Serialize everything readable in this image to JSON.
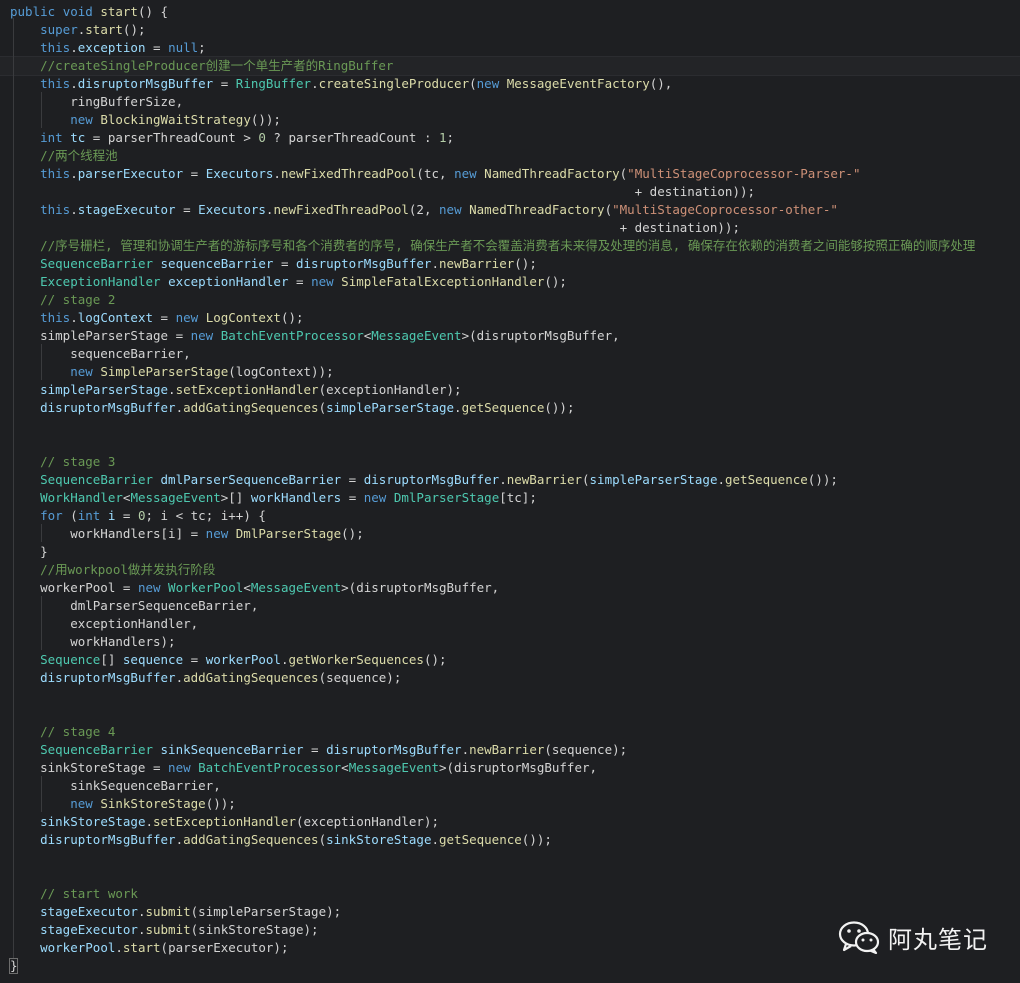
{
  "editor": {
    "background": "#1e1f22",
    "lines": [
      [
        [
          "kw",
          "public"
        ],
        [
          "pl",
          " "
        ],
        [
          "kw",
          "void"
        ],
        [
          "pl",
          " "
        ],
        [
          "fn",
          "start"
        ],
        [
          "pl",
          "() {"
        ]
      ],
      [
        [
          "pl",
          "    "
        ],
        [
          "kw",
          "super"
        ],
        [
          "pl",
          "."
        ],
        [
          "fn",
          "start"
        ],
        [
          "pl",
          "();"
        ]
      ],
      [
        [
          "pl",
          "    "
        ],
        [
          "kw",
          "this"
        ],
        [
          "pl",
          "."
        ],
        [
          "id",
          "exception"
        ],
        [
          "pl",
          " = "
        ],
        [
          "kw",
          "null"
        ],
        [
          "pl",
          ";"
        ]
      ],
      [
        [
          "pl",
          "    "
        ],
        [
          "com",
          "//createSingleProducer创建一个单生产者的RingBuffer"
        ]
      ],
      [
        [
          "pl",
          "    "
        ],
        [
          "kw",
          "this"
        ],
        [
          "pl",
          "."
        ],
        [
          "id",
          "disruptorMsgBuffer"
        ],
        [
          "pl",
          " = "
        ],
        [
          "ty",
          "RingBuffer"
        ],
        [
          "pl",
          "."
        ],
        [
          "fn",
          "createSingleProducer"
        ],
        [
          "pl",
          "("
        ],
        [
          "kw",
          "new"
        ],
        [
          "pl",
          " "
        ],
        [
          "fn",
          "MessageEventFactory"
        ],
        [
          "pl",
          "(),"
        ]
      ],
      [
        [
          "pl",
          "        ringBufferSize,"
        ]
      ],
      [
        [
          "pl",
          "        "
        ],
        [
          "kw",
          "new"
        ],
        [
          "pl",
          " "
        ],
        [
          "fn",
          "BlockingWaitStrategy"
        ],
        [
          "pl",
          "());"
        ]
      ],
      [
        [
          "pl",
          "    "
        ],
        [
          "kw",
          "int"
        ],
        [
          "pl",
          " "
        ],
        [
          "id",
          "tc"
        ],
        [
          "pl",
          " = parserThreadCount > "
        ],
        [
          "num",
          "0"
        ],
        [
          "pl",
          " ? parserThreadCount : "
        ],
        [
          "num",
          "1"
        ],
        [
          "pl",
          ";"
        ]
      ],
      [
        [
          "pl",
          "    "
        ],
        [
          "com",
          "//两个线程池"
        ]
      ],
      [
        [
          "pl",
          "    "
        ],
        [
          "kw",
          "this"
        ],
        [
          "pl",
          "."
        ],
        [
          "id",
          "parserExecutor"
        ],
        [
          "pl",
          " = "
        ],
        [
          "id",
          "Executors"
        ],
        [
          "pl",
          "."
        ],
        [
          "fn",
          "newFixedThreadPool"
        ],
        [
          "pl",
          "(tc, "
        ],
        [
          "kw",
          "new"
        ],
        [
          "pl",
          " "
        ],
        [
          "fn",
          "NamedThreadFactory"
        ],
        [
          "pl",
          "("
        ],
        [
          "str",
          "\"MultiStageCoprocessor-Parser-\""
        ]
      ],
      [
        [
          "pl",
          "                                                                                   + destination));"
        ]
      ],
      [
        [
          "pl",
          "    "
        ],
        [
          "kw",
          "this"
        ],
        [
          "pl",
          "."
        ],
        [
          "id",
          "stageExecutor"
        ],
        [
          "pl",
          " = "
        ],
        [
          "id",
          "Executors"
        ],
        [
          "pl",
          "."
        ],
        [
          "fn",
          "newFixedThreadPool"
        ],
        [
          "pl",
          "(2, "
        ],
        [
          "kw",
          "new"
        ],
        [
          "pl",
          " "
        ],
        [
          "fn",
          "NamedThreadFactory"
        ],
        [
          "pl",
          "("
        ],
        [
          "str",
          "\"MultiStageCoprocessor-other-\""
        ]
      ],
      [
        [
          "pl",
          "                                                                                 + destination));"
        ]
      ],
      [
        [
          "pl",
          "    "
        ],
        [
          "com",
          "//序号栅栏, 管理和协调生产者的游标序号和各个消费者的序号, 确保生产者不会覆盖消费者未来得及处理的消息, 确保存在依赖的消费者之间能够按照正确的顺序处理"
        ]
      ],
      [
        [
          "pl",
          "    "
        ],
        [
          "ty",
          "SequenceBarrier"
        ],
        [
          "pl",
          " "
        ],
        [
          "id",
          "sequenceBarrier"
        ],
        [
          "pl",
          " = "
        ],
        [
          "id",
          "disruptorMsgBuffer"
        ],
        [
          "pl",
          "."
        ],
        [
          "fn",
          "newBarrier"
        ],
        [
          "pl",
          "();"
        ]
      ],
      [
        [
          "pl",
          "    "
        ],
        [
          "ty",
          "ExceptionHandler"
        ],
        [
          "pl",
          " "
        ],
        [
          "id",
          "exceptionHandler"
        ],
        [
          "pl",
          " = "
        ],
        [
          "kw",
          "new"
        ],
        [
          "pl",
          " "
        ],
        [
          "fn",
          "SimpleFatalExceptionHandler"
        ],
        [
          "pl",
          "();"
        ]
      ],
      [
        [
          "pl",
          "    "
        ],
        [
          "com",
          "// stage 2"
        ]
      ],
      [
        [
          "pl",
          "    "
        ],
        [
          "kw",
          "this"
        ],
        [
          "pl",
          "."
        ],
        [
          "id",
          "logContext"
        ],
        [
          "pl",
          " = "
        ],
        [
          "kw",
          "new"
        ],
        [
          "pl",
          " "
        ],
        [
          "fn",
          "LogContext"
        ],
        [
          "pl",
          "();"
        ]
      ],
      [
        [
          "pl",
          "    simpleParserStage = "
        ],
        [
          "kw",
          "new"
        ],
        [
          "pl",
          " "
        ],
        [
          "ty",
          "BatchEventProcessor"
        ],
        [
          "pl",
          "<"
        ],
        [
          "ty",
          "MessageEvent"
        ],
        [
          "pl",
          ">(disruptorMsgBuffer,"
        ]
      ],
      [
        [
          "pl",
          "        sequenceBarrier,"
        ]
      ],
      [
        [
          "pl",
          "        "
        ],
        [
          "kw",
          "new"
        ],
        [
          "pl",
          " "
        ],
        [
          "fn",
          "SimpleParserStage"
        ],
        [
          "pl",
          "(logContext));"
        ]
      ],
      [
        [
          "pl",
          "    "
        ],
        [
          "id",
          "simpleParserStage"
        ],
        [
          "pl",
          "."
        ],
        [
          "fn",
          "setExceptionHandler"
        ],
        [
          "pl",
          "(exceptionHandler);"
        ]
      ],
      [
        [
          "pl",
          "    "
        ],
        [
          "id",
          "disruptorMsgBuffer"
        ],
        [
          "pl",
          "."
        ],
        [
          "fn",
          "addGatingSequences"
        ],
        [
          "pl",
          "("
        ],
        [
          "id",
          "simpleParserStage"
        ],
        [
          "pl",
          "."
        ],
        [
          "fn",
          "getSequence"
        ],
        [
          "pl",
          "());"
        ]
      ],
      [
        [
          "pl",
          ""
        ]
      ],
      [
        [
          "pl",
          ""
        ]
      ],
      [
        [
          "pl",
          "    "
        ],
        [
          "com",
          "// stage 3"
        ]
      ],
      [
        [
          "pl",
          "    "
        ],
        [
          "ty",
          "SequenceBarrier"
        ],
        [
          "pl",
          " "
        ],
        [
          "id",
          "dmlParserSequenceBarrier"
        ],
        [
          "pl",
          " = "
        ],
        [
          "id",
          "disruptorMsgBuffer"
        ],
        [
          "pl",
          "."
        ],
        [
          "fn",
          "newBarrier"
        ],
        [
          "pl",
          "("
        ],
        [
          "id",
          "simpleParserStage"
        ],
        [
          "pl",
          "."
        ],
        [
          "fn",
          "getSequence"
        ],
        [
          "pl",
          "());"
        ]
      ],
      [
        [
          "pl",
          "    "
        ],
        [
          "ty",
          "WorkHandler"
        ],
        [
          "pl",
          "<"
        ],
        [
          "ty",
          "MessageEvent"
        ],
        [
          "pl",
          ">[] "
        ],
        [
          "id",
          "workHandlers"
        ],
        [
          "pl",
          " = "
        ],
        [
          "kw",
          "new"
        ],
        [
          "pl",
          " "
        ],
        [
          "ty",
          "DmlParserStage"
        ],
        [
          "pl",
          "[tc];"
        ]
      ],
      [
        [
          "pl",
          "    "
        ],
        [
          "kw",
          "for"
        ],
        [
          "pl",
          " ("
        ],
        [
          "kw",
          "int"
        ],
        [
          "pl",
          " "
        ],
        [
          "id",
          "i"
        ],
        [
          "pl",
          " = "
        ],
        [
          "num",
          "0"
        ],
        [
          "pl",
          "; i < tc; i++) {"
        ]
      ],
      [
        [
          "pl",
          "        workHandlers[i] = "
        ],
        [
          "kw",
          "new"
        ],
        [
          "pl",
          " "
        ],
        [
          "fn",
          "DmlParserStage"
        ],
        [
          "pl",
          "();"
        ]
      ],
      [
        [
          "pl",
          "    }"
        ]
      ],
      [
        [
          "pl",
          "    "
        ],
        [
          "com",
          "//用workpool做并发执行阶段"
        ]
      ],
      [
        [
          "pl",
          "    workerPool = "
        ],
        [
          "kw",
          "new"
        ],
        [
          "pl",
          " "
        ],
        [
          "ty",
          "WorkerPool"
        ],
        [
          "pl",
          "<"
        ],
        [
          "ty",
          "MessageEvent"
        ],
        [
          "pl",
          ">(disruptorMsgBuffer,"
        ]
      ],
      [
        [
          "pl",
          "        dmlParserSequenceBarrier,"
        ]
      ],
      [
        [
          "pl",
          "        exceptionHandler,"
        ]
      ],
      [
        [
          "pl",
          "        workHandlers);"
        ]
      ],
      [
        [
          "pl",
          "    "
        ],
        [
          "ty",
          "Sequence"
        ],
        [
          "pl",
          "[] "
        ],
        [
          "id",
          "sequence"
        ],
        [
          "pl",
          " = "
        ],
        [
          "id",
          "workerPool"
        ],
        [
          "pl",
          "."
        ],
        [
          "fn",
          "getWorkerSequences"
        ],
        [
          "pl",
          "();"
        ]
      ],
      [
        [
          "pl",
          "    "
        ],
        [
          "id",
          "disruptorMsgBuffer"
        ],
        [
          "pl",
          "."
        ],
        [
          "fn",
          "addGatingSequences"
        ],
        [
          "pl",
          "(sequence);"
        ]
      ],
      [
        [
          "pl",
          ""
        ]
      ],
      [
        [
          "pl",
          ""
        ]
      ],
      [
        [
          "pl",
          "    "
        ],
        [
          "com",
          "// stage 4"
        ]
      ],
      [
        [
          "pl",
          "    "
        ],
        [
          "ty",
          "SequenceBarrier"
        ],
        [
          "pl",
          " "
        ],
        [
          "id",
          "sinkSequenceBarrier"
        ],
        [
          "pl",
          " = "
        ],
        [
          "id",
          "disruptorMsgBuffer"
        ],
        [
          "pl",
          "."
        ],
        [
          "fn",
          "newBarrier"
        ],
        [
          "pl",
          "(sequence);"
        ]
      ],
      [
        [
          "pl",
          "    sinkStoreStage = "
        ],
        [
          "kw",
          "new"
        ],
        [
          "pl",
          " "
        ],
        [
          "ty",
          "BatchEventProcessor"
        ],
        [
          "pl",
          "<"
        ],
        [
          "ty",
          "MessageEvent"
        ],
        [
          "pl",
          ">(disruptorMsgBuffer,"
        ]
      ],
      [
        [
          "pl",
          "        sinkSequenceBarrier,"
        ]
      ],
      [
        [
          "pl",
          "        "
        ],
        [
          "kw",
          "new"
        ],
        [
          "pl",
          " "
        ],
        [
          "fn",
          "SinkStoreStage"
        ],
        [
          "pl",
          "());"
        ]
      ],
      [
        [
          "pl",
          "    "
        ],
        [
          "id",
          "sinkStoreStage"
        ],
        [
          "pl",
          "."
        ],
        [
          "fn",
          "setExceptionHandler"
        ],
        [
          "pl",
          "(exceptionHandler);"
        ]
      ],
      [
        [
          "pl",
          "    "
        ],
        [
          "id",
          "disruptorMsgBuffer"
        ],
        [
          "pl",
          "."
        ],
        [
          "fn",
          "addGatingSequences"
        ],
        [
          "pl",
          "("
        ],
        [
          "id",
          "sinkStoreStage"
        ],
        [
          "pl",
          "."
        ],
        [
          "fn",
          "getSequence"
        ],
        [
          "pl",
          "());"
        ]
      ],
      [
        [
          "pl",
          ""
        ]
      ],
      [
        [
          "pl",
          ""
        ]
      ],
      [
        [
          "pl",
          "    "
        ],
        [
          "com",
          "// start work"
        ]
      ],
      [
        [
          "pl",
          "    "
        ],
        [
          "id",
          "stageExecutor"
        ],
        [
          "pl",
          "."
        ],
        [
          "fn",
          "submit"
        ],
        [
          "pl",
          "(simpleParserStage);"
        ]
      ],
      [
        [
          "pl",
          "    "
        ],
        [
          "id",
          "stageExecutor"
        ],
        [
          "pl",
          "."
        ],
        [
          "fn",
          "submit"
        ],
        [
          "pl",
          "(sinkStoreStage);"
        ]
      ],
      [
        [
          "pl",
          "    "
        ],
        [
          "id",
          "workerPool"
        ],
        [
          "pl",
          "."
        ],
        [
          "fn",
          "start"
        ],
        [
          "pl",
          "(parserExecutor);"
        ]
      ],
      [
        [
          "pl",
          "}"
        ]
      ]
    ]
  },
  "watermark": {
    "icon": "wechat-icon",
    "text": "阿丸笔记"
  }
}
